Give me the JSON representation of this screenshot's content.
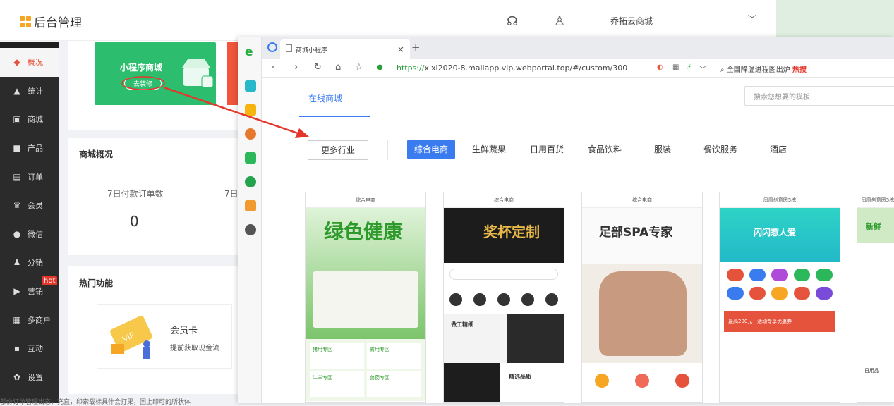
{
  "header": {
    "logo": "后台管理",
    "shop_name": "乔拓云商城"
  },
  "sidebar": {
    "items": [
      {
        "label": "概况",
        "icon": "compass-icon",
        "glyph": "◆"
      },
      {
        "label": "统计",
        "icon": "chart-icon",
        "glyph": "▲"
      },
      {
        "label": "商城",
        "icon": "store-icon",
        "glyph": "▣"
      },
      {
        "label": "产品",
        "icon": "grid-icon",
        "glyph": "■"
      },
      {
        "label": "订单",
        "icon": "order-icon",
        "glyph": "▤"
      },
      {
        "label": "会员",
        "icon": "crown-icon",
        "glyph": "♛"
      },
      {
        "label": "微信",
        "icon": "wechat-icon",
        "glyph": "●"
      },
      {
        "label": "分销",
        "icon": "users-icon",
        "glyph": "♟"
      },
      {
        "label": "营销",
        "icon": "flag-icon",
        "glyph": "▶"
      },
      {
        "label": "多商户",
        "icon": "merchant-icon",
        "glyph": "▦"
      },
      {
        "label": "互动",
        "icon": "interact-icon",
        "glyph": "▪"
      },
      {
        "label": "设置",
        "icon": "gear-icon",
        "glyph": "✿"
      }
    ],
    "hot_badge": "hot"
  },
  "main": {
    "mini_program": {
      "title": "小程序商城",
      "button": "去装修"
    },
    "overview": {
      "title": "商城概况",
      "stat_label": "7日付款订单数",
      "stat_label2": "7日",
      "stat_value": "0"
    },
    "hot_features": {
      "title": "热门功能",
      "vip_title": "会员卡",
      "vip_desc": "提前获取现金流"
    },
    "footer_text": "部份订单管理出态，充直，印索载标具什会打果，回上印可的所状体"
  },
  "browser": {
    "tab_title": "商城小程序",
    "url_scheme": "https://",
    "url_rest": "xixi2020-8.mallapp.vip.webportal.top/#/custom/300",
    "search_hint": "全国降温进程图出炉",
    "hot_tag": "热搜"
  },
  "portal": {
    "online_tab": "在线商城",
    "search_placeholder": "搜索您想要的模板",
    "more_industry": "更多行业",
    "categories": [
      "综合电商",
      "生鲜蔬果",
      "日用百货",
      "食品饮料",
      "服装",
      "餐饮服务",
      "酒店"
    ],
    "templates": [
      {
        "header": "综合电商",
        "headline": "绿色健康"
      },
      {
        "header": "综合电商",
        "headline": "奖杯定制"
      },
      {
        "header": "综合电商",
        "headline": "足部SPA专家"
      },
      {
        "header": "凤凰创意园5栋",
        "headline": "闪闪惹人爱"
      },
      {
        "header": "凤凰创意园5栋",
        "headline": "新鲜"
      }
    ],
    "template_labels": {
      "zone1": "猪用专区",
      "zone2": "禽用专区",
      "zone3": "牛羊专区",
      "zone4": "兽药专区",
      "craft": "做工精细",
      "quality": "精选品质",
      "promo": "最高200元 · 活动专享优惠券",
      "daily": "日用品"
    }
  },
  "colors": {
    "accent": "#3a7cf0",
    "green": "#2dbd6e",
    "red": "#e5533c",
    "sidebar": "#2b2b2b"
  }
}
